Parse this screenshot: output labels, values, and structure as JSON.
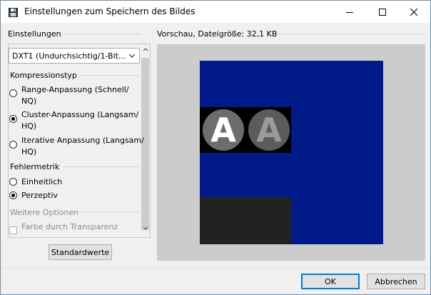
{
  "window": {
    "title": "Einstellungen zum Speichern des Bildes",
    "title_icon": "floppy-disk-icon"
  },
  "settings": {
    "heading": "Einstellungen",
    "format_select": {
      "value": "DXT1 (Undurchsichtig/1-Bit..."
    },
    "compression": {
      "heading": "Kompressionstyp",
      "options": [
        {
          "line1": "Range-Anpassung (Schnell/",
          "line2": "NQ)",
          "checked": false
        },
        {
          "line1": "Cluster-Anpassung (Langsam/",
          "line2": "HQ)",
          "checked": true
        },
        {
          "line1": "Iterative Anpassung (Langsam/",
          "line2": "HQ)",
          "checked": false
        }
      ]
    },
    "metric": {
      "heading": "Fehlermetrik",
      "options": [
        {
          "label": "Einheitlich",
          "checked": false
        },
        {
          "label": "Perzeptiv",
          "checked": true
        }
      ]
    },
    "more_options": {
      "heading": "Weitere Optionen",
      "transparency_checkbox": "Farbe durch Transparenz"
    },
    "defaults_button": "Standardwerte"
  },
  "preview": {
    "label": "Vorschau, Dateigröße: 32,1 KB",
    "letter_left": "A",
    "letter_right": "A",
    "colors": {
      "background": "#cccccc",
      "canvas": "#001a8a",
      "icon_strip": "#000000",
      "dark_block": "#222222"
    }
  },
  "footer": {
    "ok_label": "OK",
    "cancel_label": "Abbrechen"
  }
}
